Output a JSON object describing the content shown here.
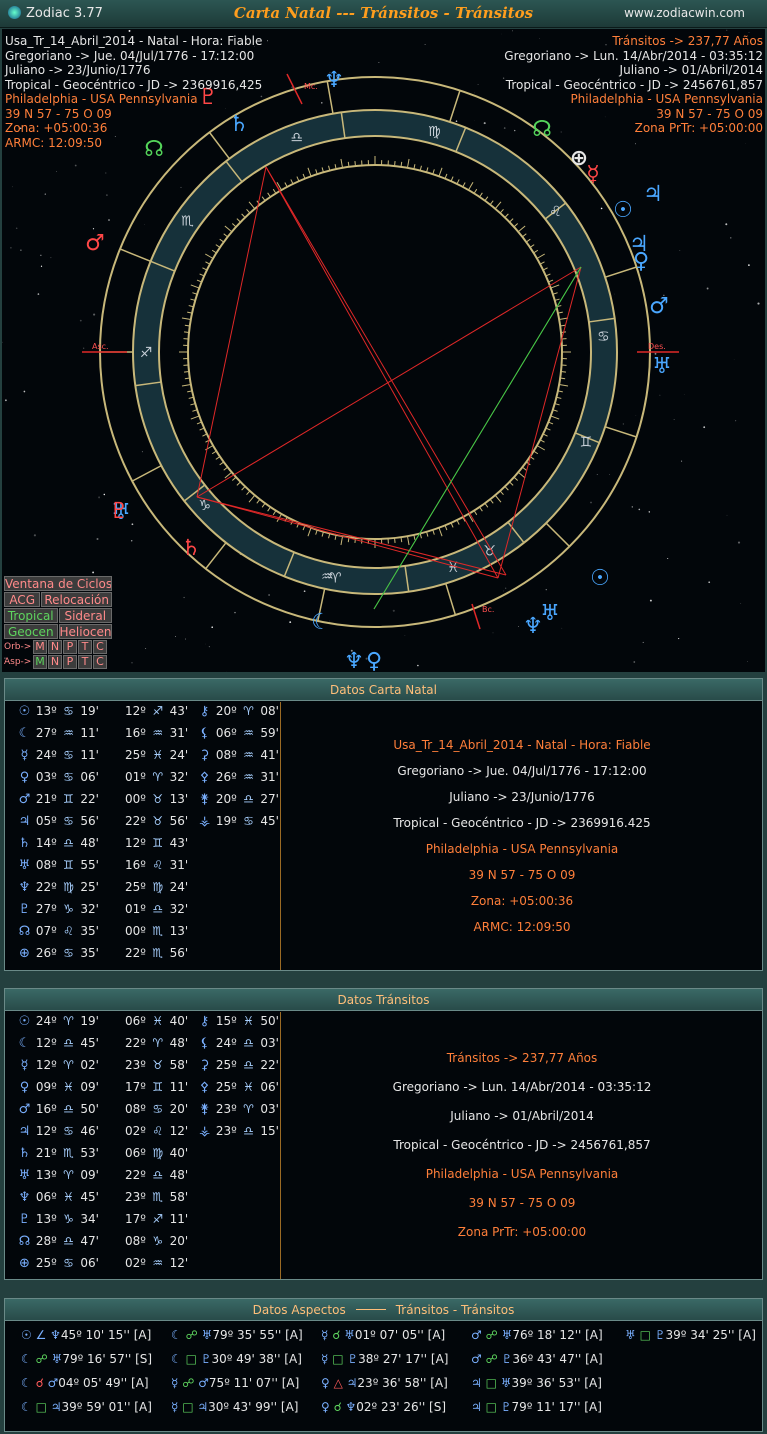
{
  "window": {
    "app_name": "Zodiac 3.77",
    "title": "Carta Natal --- Tránsitos - Tránsitos",
    "site": "www.zodiacwin.com"
  },
  "natal_info": {
    "name": "Usa_Tr_14_Abril_2014 - Natal - Hora: Fiable",
    "gregorian": "Gregoriano -> Jue. 04/Jul/1776 - 17:12:00",
    "julian": "Juliano -> 23/Junio/1776",
    "tropical": "Tropical - Geocéntrico - JD -> 2369916,425",
    "place": "Philadelphia - USA Pennsylvania",
    "coords": "39 N 57 - 75 O 09",
    "zone": "Zona: +05:00:36",
    "armc": "ARMC: 12:09:50",
    "tropical_panel": "Tropical - Geocéntrico - JD -> 2369916.425"
  },
  "transit_info": {
    "years": "Tránsitos -> 237,77 Años",
    "gregorian": "Gregoriano -> Lun. 14/Abr/2014 - 03:35:12",
    "julian": "Juliano -> 01/Abril/2014",
    "tropical": "Tropical - Geocéntrico - JD -> 2456761,857",
    "place": "Philadelphia - USA Pennsylvania",
    "coords": "39 N 57 - 75 O 09",
    "zone": "Zona PrTr: +05:00:00",
    "zone_panel": "Zona PrTr: +05:00:00"
  },
  "wheel_labels": {
    "asc": "Asc.",
    "des": "Des.",
    "mc": "Mc.",
    "bc": "Bc."
  },
  "menu": {
    "ventana": "Ventana de Ciclos",
    "acg": "ACG",
    "relocacion": "Relocación",
    "tropical": "Tropical",
    "sideral": "Sideral",
    "geocen": "Geocen",
    "heliocen": "Heliocen",
    "orb_label": "Orb->",
    "asp_label": "Asp->",
    "toggles": [
      "M",
      "N",
      "P",
      "T",
      "C"
    ]
  },
  "panels": {
    "natal_title": "Datos Carta Natal",
    "transit_title": "Datos Tránsitos",
    "aspects_title": "Datos Aspectos",
    "aspects_subtitle": "Tránsitos - Tránsitos"
  },
  "natal_positions": {
    "planets": [
      {
        "glyph": "☉",
        "deg": "13º",
        "sign": "♋",
        "min": "19'"
      },
      {
        "glyph": "☾",
        "deg": "27º",
        "sign": "♒",
        "min": "11'"
      },
      {
        "glyph": "☿",
        "deg": "24º",
        "sign": "♋",
        "min": "11'"
      },
      {
        "glyph": "♀",
        "deg": "03º",
        "sign": "♋",
        "min": "06'"
      },
      {
        "glyph": "♂",
        "deg": "21º",
        "sign": "♊",
        "min": "22'"
      },
      {
        "glyph": "♃",
        "deg": "05º",
        "sign": "♋",
        "min": "56'"
      },
      {
        "glyph": "♄",
        "deg": "14º",
        "sign": "♎",
        "min": "48'"
      },
      {
        "glyph": "♅",
        "deg": "08º",
        "sign": "♊",
        "min": "55'"
      },
      {
        "glyph": "♆",
        "deg": "22º",
        "sign": "♍",
        "min": "25'"
      },
      {
        "glyph": "♇",
        "deg": "27º",
        "sign": "♑",
        "min": "32'"
      },
      {
        "glyph": "☊",
        "deg": "07º",
        "sign": "♌",
        "min": "35'"
      },
      {
        "glyph": "⊕",
        "deg": "26º",
        "sign": "♋",
        "min": "35'"
      }
    ],
    "houses": [
      {
        "deg": "12º",
        "sign": "♐",
        "min": "43'"
      },
      {
        "deg": "16º",
        "sign": "♒",
        "min": "31'"
      },
      {
        "deg": "25º",
        "sign": "♓",
        "min": "24'"
      },
      {
        "deg": "01º",
        "sign": "♈",
        "min": "32'"
      },
      {
        "deg": "00º",
        "sign": "♉",
        "min": "13'"
      },
      {
        "deg": "22º",
        "sign": "♉",
        "min": "56'"
      },
      {
        "deg": "12º",
        "sign": "♊",
        "min": "43'"
      },
      {
        "deg": "16º",
        "sign": "♌",
        "min": "31'"
      },
      {
        "deg": "25º",
        "sign": "♍",
        "min": "24'"
      },
      {
        "deg": "01º",
        "sign": "♎",
        "min": "32'"
      },
      {
        "deg": "00º",
        "sign": "♏",
        "min": "13'"
      },
      {
        "deg": "22º",
        "sign": "♏",
        "min": "56'"
      }
    ],
    "others": [
      {
        "glyph": "⚷",
        "deg": "20º",
        "sign": "♈",
        "min": "08'"
      },
      {
        "glyph": "⚸",
        "deg": "06º",
        "sign": "♒",
        "min": "59'"
      },
      {
        "glyph": "⚳",
        "deg": "08º",
        "sign": "♒",
        "min": "41'"
      },
      {
        "glyph": "⚴",
        "deg": "26º",
        "sign": "♒",
        "min": "31'"
      },
      {
        "glyph": "⚵",
        "deg": "20º",
        "sign": "♎",
        "min": "27'"
      },
      {
        "glyph": "⚶",
        "deg": "19º",
        "sign": "♋",
        "min": "45'"
      }
    ]
  },
  "transit_positions": {
    "planets": [
      {
        "glyph": "☉",
        "deg": "24º",
        "sign": "♈",
        "min": "19'"
      },
      {
        "glyph": "☾",
        "deg": "12º",
        "sign": "♎",
        "min": "45'"
      },
      {
        "glyph": "☿",
        "deg": "12º",
        "sign": "♈",
        "min": "02'"
      },
      {
        "glyph": "♀",
        "deg": "09º",
        "sign": "♓",
        "min": "09'"
      },
      {
        "glyph": "♂",
        "deg": "16º",
        "sign": "♎",
        "min": "50'"
      },
      {
        "glyph": "♃",
        "deg": "12º",
        "sign": "♋",
        "min": "46'"
      },
      {
        "glyph": "♄",
        "deg": "21º",
        "sign": "♏",
        "min": "53'"
      },
      {
        "glyph": "♅",
        "deg": "13º",
        "sign": "♈",
        "min": "09'"
      },
      {
        "glyph": "♆",
        "deg": "06º",
        "sign": "♓",
        "min": "45'"
      },
      {
        "glyph": "♇",
        "deg": "13º",
        "sign": "♑",
        "min": "34'"
      },
      {
        "glyph": "☊",
        "deg": "28º",
        "sign": "♎",
        "min": "47'"
      },
      {
        "glyph": "⊕",
        "deg": "25º",
        "sign": "♋",
        "min": "06'"
      }
    ],
    "houses": [
      {
        "deg": "06º",
        "sign": "♓",
        "min": "40'"
      },
      {
        "deg": "22º",
        "sign": "♈",
        "min": "48'"
      },
      {
        "deg": "23º",
        "sign": "♉",
        "min": "58'"
      },
      {
        "deg": "17º",
        "sign": "♊",
        "min": "11'"
      },
      {
        "deg": "08º",
        "sign": "♋",
        "min": "20'"
      },
      {
        "deg": "02º",
        "sign": "♌",
        "min": "12'"
      },
      {
        "deg": "06º",
        "sign": "♍",
        "min": "40'"
      },
      {
        "deg": "22º",
        "sign": "♎",
        "min": "48'"
      },
      {
        "deg": "23º",
        "sign": "♏",
        "min": "58'"
      },
      {
        "deg": "17º",
        "sign": "♐",
        "min": "11'"
      },
      {
        "deg": "08º",
        "sign": "♑",
        "min": "20'"
      },
      {
        "deg": "02º",
        "sign": "♒",
        "min": "12'"
      }
    ],
    "others": [
      {
        "glyph": "⚷",
        "deg": "15º",
        "sign": "♓",
        "min": "50'"
      },
      {
        "glyph": "⚸",
        "deg": "24º",
        "sign": "♎",
        "min": "03'"
      },
      {
        "glyph": "⚳",
        "deg": "25º",
        "sign": "♎",
        "min": "22'"
      },
      {
        "glyph": "⚴",
        "deg": "25º",
        "sign": "♓",
        "min": "06'"
      },
      {
        "glyph": "⚵",
        "deg": "23º",
        "sign": "♈",
        "min": "03'"
      },
      {
        "glyph": "⚶",
        "deg": "23º",
        "sign": "♎",
        "min": "15'"
      }
    ]
  },
  "aspects": [
    [
      {
        "p1": "☉",
        "asp": "∠",
        "p2": "♆",
        "val": "45º 10' 15'' [A]",
        "ac": "a"
      },
      {
        "p1": "☾",
        "asp": "☍",
        "p2": "♅",
        "val": "79º 35' 55'' [A]",
        "ac": "g"
      },
      {
        "p1": "☿",
        "asp": "☌",
        "p2": "♅",
        "val": "01º 07' 05'' [A]",
        "ac": "g"
      },
      {
        "p1": "♂",
        "asp": "☍",
        "p2": "♅",
        "val": "76º 18' 12'' [A]",
        "ac": "g"
      },
      {
        "p1": "♅",
        "asp": "□",
        "p2": "♇",
        "val": "39º 34' 25'' [A]",
        "ac": "g"
      }
    ],
    [
      {
        "p1": "☾",
        "asp": "☍",
        "p2": "♅",
        "val": "79º 16' 57'' [S]",
        "ac": "g"
      },
      {
        "p1": "☾",
        "asp": "□",
        "p2": "♇",
        "val": "30º 49' 38'' [A]",
        "ac": "g"
      },
      {
        "p1": "☿",
        "asp": "□",
        "p2": "♇",
        "val": "38º 27' 17'' [A]",
        "ac": "g"
      },
      {
        "p1": "♂",
        "asp": "☍",
        "p2": "♇",
        "val": "36º 43' 47'' [A]",
        "ac": "g"
      }
    ],
    [
      {
        "p1": "☾",
        "asp": "☌",
        "p2": "♂",
        "val": "04º 05' 49'' [A]",
        "ac": "r"
      },
      {
        "p1": "☿",
        "asp": "☍",
        "p2": "♂",
        "val": "75º 11' 07'' [A]",
        "ac": "g"
      },
      {
        "p1": "♀",
        "asp": "△",
        "p2": "♃",
        "val": "23º 36' 58'' [A]",
        "ac": "r"
      },
      {
        "p1": "♃",
        "asp": "□",
        "p2": "♅",
        "val": "39º 36' 53'' [A]",
        "ac": "g"
      }
    ],
    [
      {
        "p1": "☾",
        "asp": "□",
        "p2": "♃",
        "val": "39º 59' 01'' [A]",
        "ac": "g"
      },
      {
        "p1": "☿",
        "asp": "□",
        "p2": "♃",
        "val": "30º 43' 99'' [A]",
        "ac": "g"
      },
      {
        "p1": "♀",
        "asp": "☌",
        "p2": "♆",
        "val": "02º 23' 26'' [S]",
        "ac": "g"
      },
      {
        "p1": "♃",
        "asp": "□",
        "p2": "♇",
        "val": "79º 11' 17'' [A]",
        "ac": "g"
      }
    ]
  ],
  "wheel": {
    "signs": [
      "♈",
      "♉",
      "♊",
      "♋",
      "♌",
      "♍",
      "♎",
      "♏",
      "♐",
      "♑",
      "♒",
      "♓"
    ],
    "outer_glyphs": [
      {
        "g": "♆",
        "color": "#4aa7ff",
        "name": "neptune-outer-icon"
      },
      {
        "g": "♄",
        "color": "#4aa7ff",
        "name": "saturn-outer-icon"
      },
      {
        "g": "☊",
        "color": "#54d45a",
        "name": "node-outer-icon"
      },
      {
        "g": "♇",
        "color": "#ff4747",
        "name": "pluto-outer-icon"
      },
      {
        "g": "☊",
        "color": "#54d45a",
        "name": "node-right-icon"
      },
      {
        "g": "⊕",
        "color": "#e6e6e6",
        "name": "part-fortune-icon"
      },
      {
        "g": "☿",
        "color": "#ff4747",
        "name": "mercury-outer-icon"
      },
      {
        "g": "♃",
        "color": "#4aa7ff",
        "name": "jupiter-outer-icon"
      },
      {
        "g": "☉",
        "color": "#4aa7ff",
        "name": "sun-outer-icon"
      },
      {
        "g": "♃",
        "color": "#4aa7ff",
        "name": "jupiter-right-icon"
      },
      {
        "g": "♀",
        "color": "#4aa7ff",
        "name": "venus-outer-icon"
      },
      {
        "g": "♂",
        "color": "#4aa7ff",
        "name": "mars-outer-icon"
      },
      {
        "g": "♅",
        "color": "#4aa7ff",
        "name": "uranus-outer-icon"
      },
      {
        "g": "☉",
        "color": "#4aa7ff",
        "name": "sun-bottom-icon"
      },
      {
        "g": "♅",
        "color": "#4aa7ff",
        "name": "uranus-bottom-icon"
      },
      {
        "g": "♆",
        "color": "#4aa7ff",
        "name": "neptune-bottom-icon"
      },
      {
        "g": "☾",
        "color": "#4aa7ff",
        "name": "moon-bottom-icon"
      },
      {
        "g": "♀",
        "color": "#4aa7ff",
        "name": "venus-bottom-icon"
      },
      {
        "g": "♆",
        "color": "#4aa7ff",
        "name": "neptune-bottom2-icon"
      },
      {
        "g": "♂",
        "color": "#ff4747",
        "name": "mars-left-icon"
      },
      {
        "g": "♅",
        "color": "#4aa7ff",
        "name": "uranus-left-icon"
      },
      {
        "g": "♄",
        "color": "#ff4747",
        "name": "saturn-left-icon"
      },
      {
        "g": "♇",
        "color": "#ff4747",
        "name": "pluto-left-icon"
      }
    ]
  }
}
